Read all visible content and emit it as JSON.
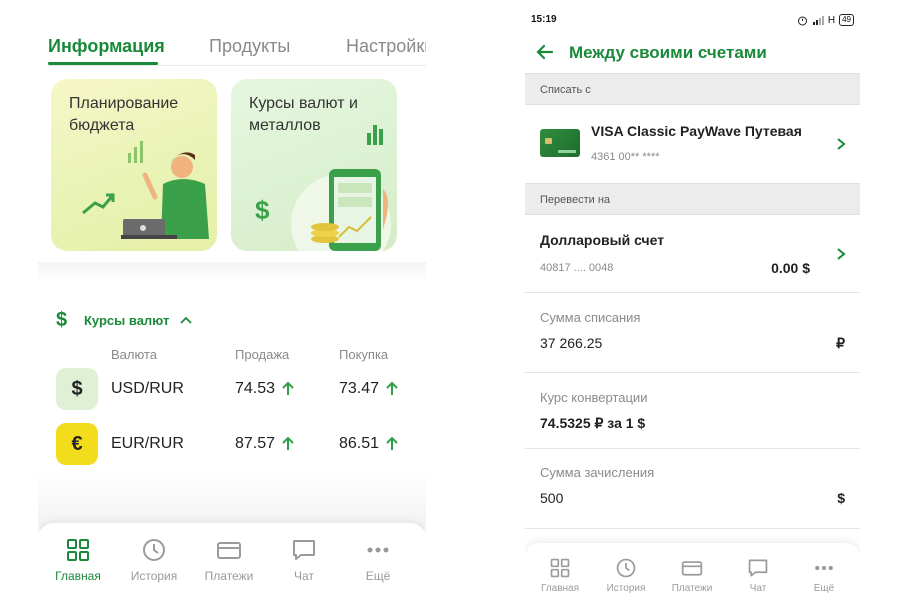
{
  "left": {
    "tabs": [
      {
        "label": "Информация",
        "active": true
      },
      {
        "label": "Продукты",
        "active": false
      },
      {
        "label": "Настройки",
        "active": false
      }
    ],
    "cards": {
      "budget": {
        "title": "Планирование бюджета",
        "icon": "budget-illustration"
      },
      "rates": {
        "title": "Курсы валют и металлов",
        "icon": "rates-illustration"
      }
    },
    "rates": {
      "title": "Курсы валют",
      "columns": {
        "currency": "Валюта",
        "sell": "Продажа",
        "buy": "Покупка"
      },
      "rows": [
        {
          "symbol": "$",
          "pair": "USD/RUR",
          "sell": "74.53",
          "buy": "73.47",
          "badge_color": "#dff0d4",
          "trend": "up"
        },
        {
          "symbol": "€",
          "pair": "EUR/RUR",
          "sell": "87.57",
          "buy": "86.51",
          "badge_color": "#f2dc1c",
          "trend": "up"
        }
      ]
    },
    "nav": [
      {
        "label": "Главная",
        "icon": "grid-icon",
        "active": true
      },
      {
        "label": "История",
        "icon": "clock-icon",
        "active": false
      },
      {
        "label": "Платежи",
        "icon": "card-icon",
        "active": false
      },
      {
        "label": "Чат",
        "icon": "chat-icon",
        "active": false
      },
      {
        "label": "Ещё",
        "icon": "more-icon",
        "active": false
      }
    ]
  },
  "right": {
    "status": {
      "time": "15:19",
      "network": "H",
      "battery": "49"
    },
    "title": "Между своими счетами",
    "from_label": "Списать с",
    "from_account": {
      "name": "VISA Classic PayWave Путевая",
      "number": "4361 00** ****"
    },
    "to_label": "Перевести на",
    "to_account": {
      "name": "Долларовый счет",
      "number": "40817 .... 0048",
      "balance": "0.00 $"
    },
    "fields": [
      {
        "label": "Сумма списания",
        "value": "37 266.25",
        "unit": "₽"
      },
      {
        "label": "Курс конвертации",
        "value": "74.5325 ₽ за 1 $",
        "unit": ""
      },
      {
        "label": "Сумма зачисления",
        "value": "500",
        "unit": "$"
      }
    ],
    "nav": [
      {
        "label": "Главная",
        "icon": "grid-icon"
      },
      {
        "label": "История",
        "icon": "clock-icon"
      },
      {
        "label": "Платежи",
        "icon": "card-icon"
      },
      {
        "label": "Чат",
        "icon": "chat-icon"
      },
      {
        "label": "Ещё",
        "icon": "more-icon"
      }
    ]
  },
  "colors": {
    "brand_green": "#1a8a3a",
    "inactive_grey": "#9a9a9a",
    "trend_up": "#2e9e4a"
  }
}
